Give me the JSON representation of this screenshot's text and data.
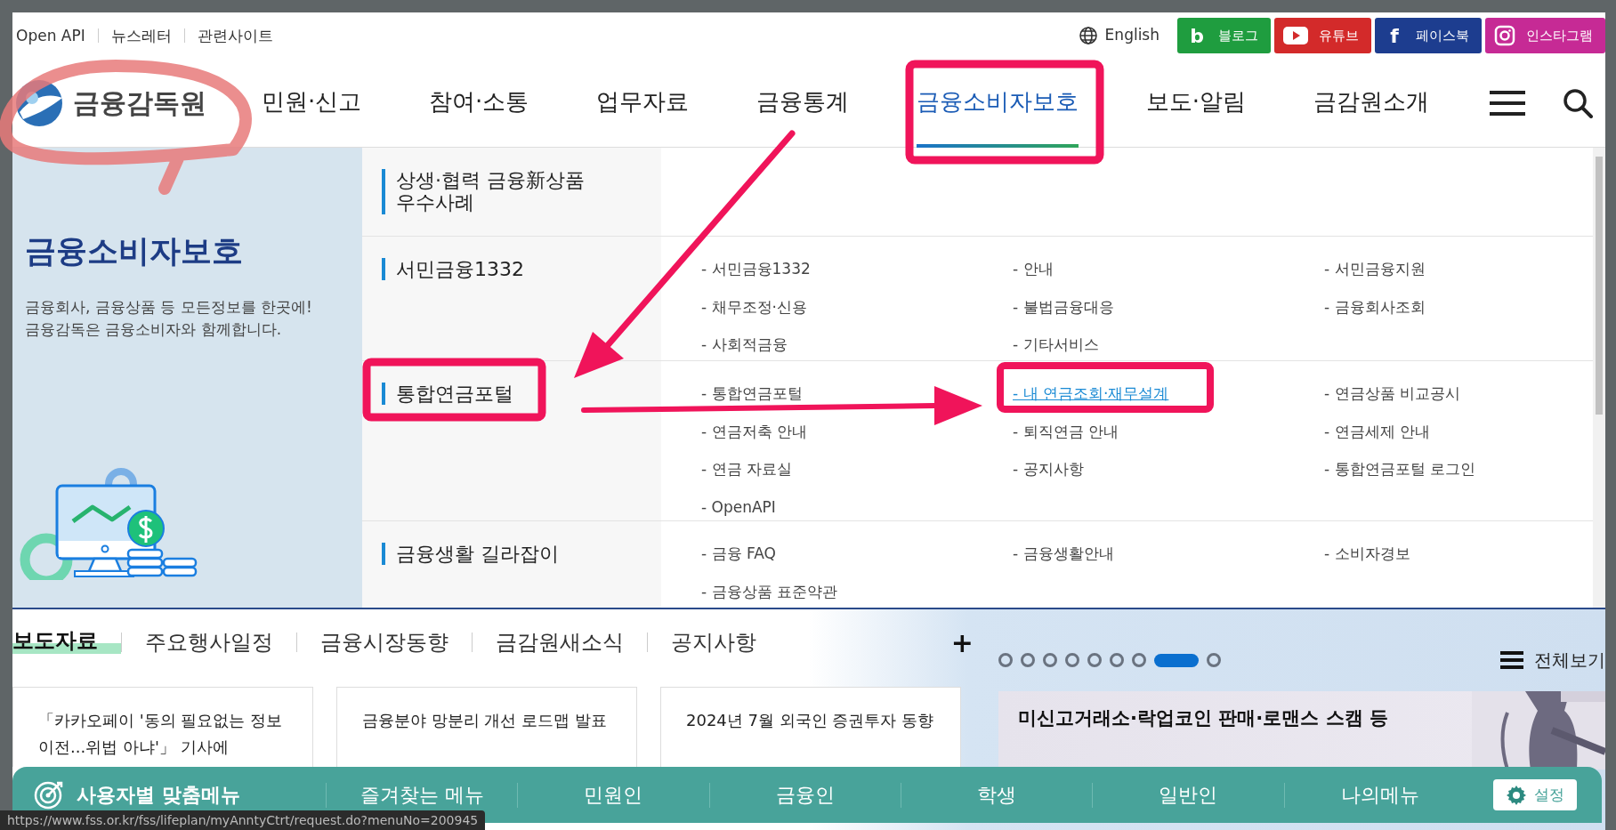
{
  "utility_links": [
    "Open API",
    "뉴스레터",
    "관련사이트"
  ],
  "language": "English",
  "social_links": [
    {
      "kind": "blog",
      "glyph": "b",
      "label": "블로그",
      "color": "#1f9d3f"
    },
    {
      "kind": "youtube",
      "label": "유튜브",
      "color": "#d32a2a"
    },
    {
      "kind": "facebook",
      "glyph": "f",
      "label": "페이스북",
      "color": "#1d3d8f"
    },
    {
      "kind": "instagram",
      "label": "인스타그램",
      "color": "#c62a95"
    }
  ],
  "logo": {
    "text": "금융감독원"
  },
  "nav": [
    {
      "label": "민원·신고",
      "selected": false
    },
    {
      "label": "참여·소통",
      "selected": false
    },
    {
      "label": "업무자료",
      "selected": false
    },
    {
      "label": "금융통계",
      "selected": false
    },
    {
      "label": "금융소비자보호",
      "selected": true
    },
    {
      "label": "보도·알림",
      "selected": false
    },
    {
      "label": "금감원소개",
      "selected": false
    }
  ],
  "mega_menu": {
    "title": "금융소비자보호",
    "description": "금융회사, 금융상품 등 모든정보를 한곳에!\n금융감독은 금융소비자와 함께합니다.",
    "groups": [
      {
        "title": "상생·협력 금융新상품 우수사례"
      },
      {
        "title": "서민금융1332",
        "links": [
          {
            "label": "- 서민금융1332",
            "hovered": false
          },
          {
            "label": "- 안내",
            "hovered": false
          },
          {
            "label": "- 서민금융지원",
            "hovered": false
          },
          {
            "label": "- 채무조정·신용",
            "hovered": false
          },
          {
            "label": "- 불법금융대응",
            "hovered": false
          },
          {
            "label": "- 금융회사조회",
            "hovered": false
          },
          {
            "label": "- 사회적금융",
            "hovered": false
          },
          {
            "label": "- 기타서비스",
            "hovered": false
          }
        ]
      },
      {
        "title": "통합연금포털",
        "links": [
          {
            "label": "- 통합연금포털",
            "hovered": false
          },
          {
            "label": "- 내 연금조회·재무설계",
            "hovered": true
          },
          {
            "label": "- 연금상품 비교공시",
            "hovered": false
          },
          {
            "label": "- 연금저축 안내",
            "hovered": false
          },
          {
            "label": "- 퇴직연금 안내",
            "hovered": false
          },
          {
            "label": "- 연금세제 안내",
            "hovered": false
          },
          {
            "label": "- 연금 자료실",
            "hovered": false
          },
          {
            "label": "- 공지사항",
            "hovered": false
          },
          {
            "label": "- 통합연금포털 로그인",
            "hovered": false
          },
          {
            "label": "- OpenAPI",
            "hovered": false
          }
        ]
      },
      {
        "title": "금융생활 길라잡이",
        "links": [
          {
            "label": "- 금융 FAQ",
            "hovered": false
          },
          {
            "label": "- 금융생활안내",
            "hovered": false
          },
          {
            "label": "- 소비자경보",
            "hovered": false
          },
          {
            "label": "- 금융상품 표준약관",
            "hovered": false
          }
        ]
      }
    ]
  },
  "news_tabs": [
    {
      "label": "보도자료",
      "selected": true
    },
    {
      "label": "주요행사일정",
      "selected": false
    },
    {
      "label": "금융시장동향",
      "selected": false
    },
    {
      "label": "금감원새소식",
      "selected": false
    },
    {
      "label": "공지사항",
      "selected": false
    }
  ],
  "more_button": "+",
  "news_cards": [
    "「카카오페이 '동의 필요없는 정보이전...위법 아냐'」 기사에",
    "금융분야 망분리 개선 로드맵 발표",
    "2024년 7월 외국인 증권투자 동향"
  ],
  "carousel": {
    "dots": [
      {
        "selected": false
      },
      {
        "selected": false
      },
      {
        "selected": false
      },
      {
        "selected": false
      },
      {
        "selected": false
      },
      {
        "selected": false
      },
      {
        "selected": false
      },
      {
        "selected": true
      },
      {
        "selected": false
      }
    ],
    "view_all": "전체보기",
    "banner": {
      "subtitle": "미신고거래소·락업코인 판매·로맨스 스캠 등"
    }
  },
  "user_menu": {
    "title": "사용자별 맞춤메뉴",
    "items": [
      "즐겨찾는 메뉴",
      "민원인",
      "금융인",
      "학생",
      "일반인",
      "나의메뉴"
    ],
    "settings": "설정"
  },
  "status_url": "https://www.fss.or.kr/fss/lifeplan/myAnntyCtrt/request.do?menuNo=200945"
}
